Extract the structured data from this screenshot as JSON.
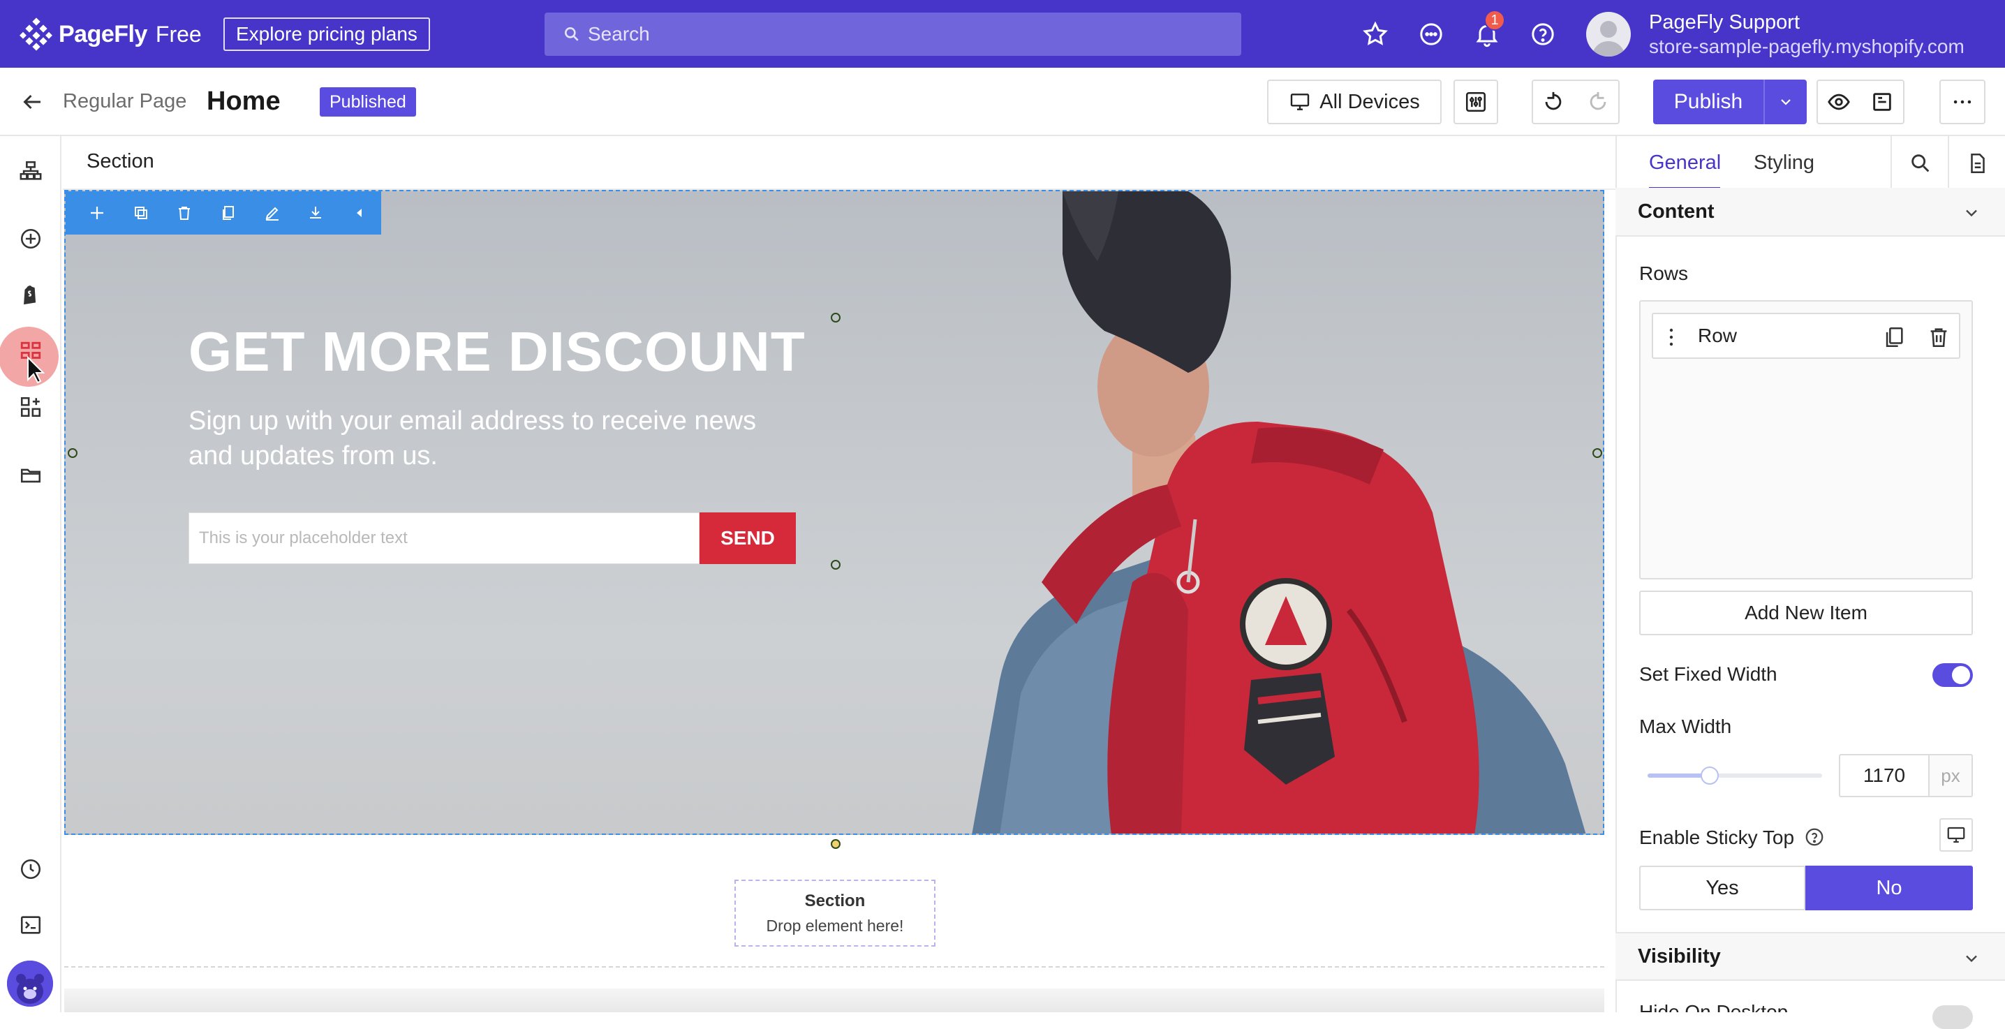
{
  "app": {
    "brand": "PageFly",
    "plan": "Free",
    "pricing_button": "Explore pricing plans",
    "search_placeholder": "Search",
    "notification_count": "1",
    "user_name": "PageFly Support",
    "user_store": "store-sample-pagefly.myshopify.com"
  },
  "subbar": {
    "page_type": "Regular Page",
    "page_title": "Home",
    "status": "Published",
    "devices_label": "All Devices",
    "publish_label": "Publish"
  },
  "canvas": {
    "section_label": "Section",
    "hero_title": "GET MORE DISCOUNT",
    "hero_subtitle": "Sign up with your email address to receive news and updates from us.",
    "input_placeholder": "This is your placeholder text",
    "send_label": "SEND",
    "drop_title": "Section",
    "drop_subtitle": "Drop element here!"
  },
  "panel": {
    "tabs": [
      "General",
      "Styling"
    ],
    "content_group": "Content",
    "rows_label": "Rows",
    "row_item": "Row",
    "add_item": "Add New Item",
    "fixed_width_label": "Set Fixed Width",
    "fixed_width_on": true,
    "max_width_label": "Max Width",
    "max_width_value": "1170",
    "max_width_unit": "px",
    "sticky_label": "Enable Sticky Top",
    "sticky_yes": "Yes",
    "sticky_no": "No",
    "sticky_selected": "No",
    "visibility_group": "Visibility",
    "hide_desktop_label": "Hide On Desktop"
  },
  "colors": {
    "brand_purple": "#4735c9",
    "accent_purple": "#5b4ce0",
    "selection_blue": "#3a8ee6",
    "send_red": "#d6293a",
    "backpack_red": "#c8283a"
  },
  "icons": [
    "pagefly-logo-icon",
    "search-icon",
    "star-icon",
    "chat-icon",
    "bell-icon",
    "help-icon",
    "back-arrow-icon",
    "monitor-icon",
    "sliders-icon",
    "undo-icon",
    "redo-icon",
    "chevron-down-icon",
    "eye-icon",
    "save-icon",
    "more-icon",
    "layers-icon",
    "add-circle-icon",
    "shopify-icon",
    "grid-icon",
    "widgets-icon",
    "folder-icon",
    "history-icon",
    "terminal-icon",
    "move-icon",
    "duplicate-icon",
    "delete-icon",
    "copy-icon",
    "edit-icon",
    "download-icon",
    "collapse-icon",
    "search-icon",
    "document-icon"
  ]
}
